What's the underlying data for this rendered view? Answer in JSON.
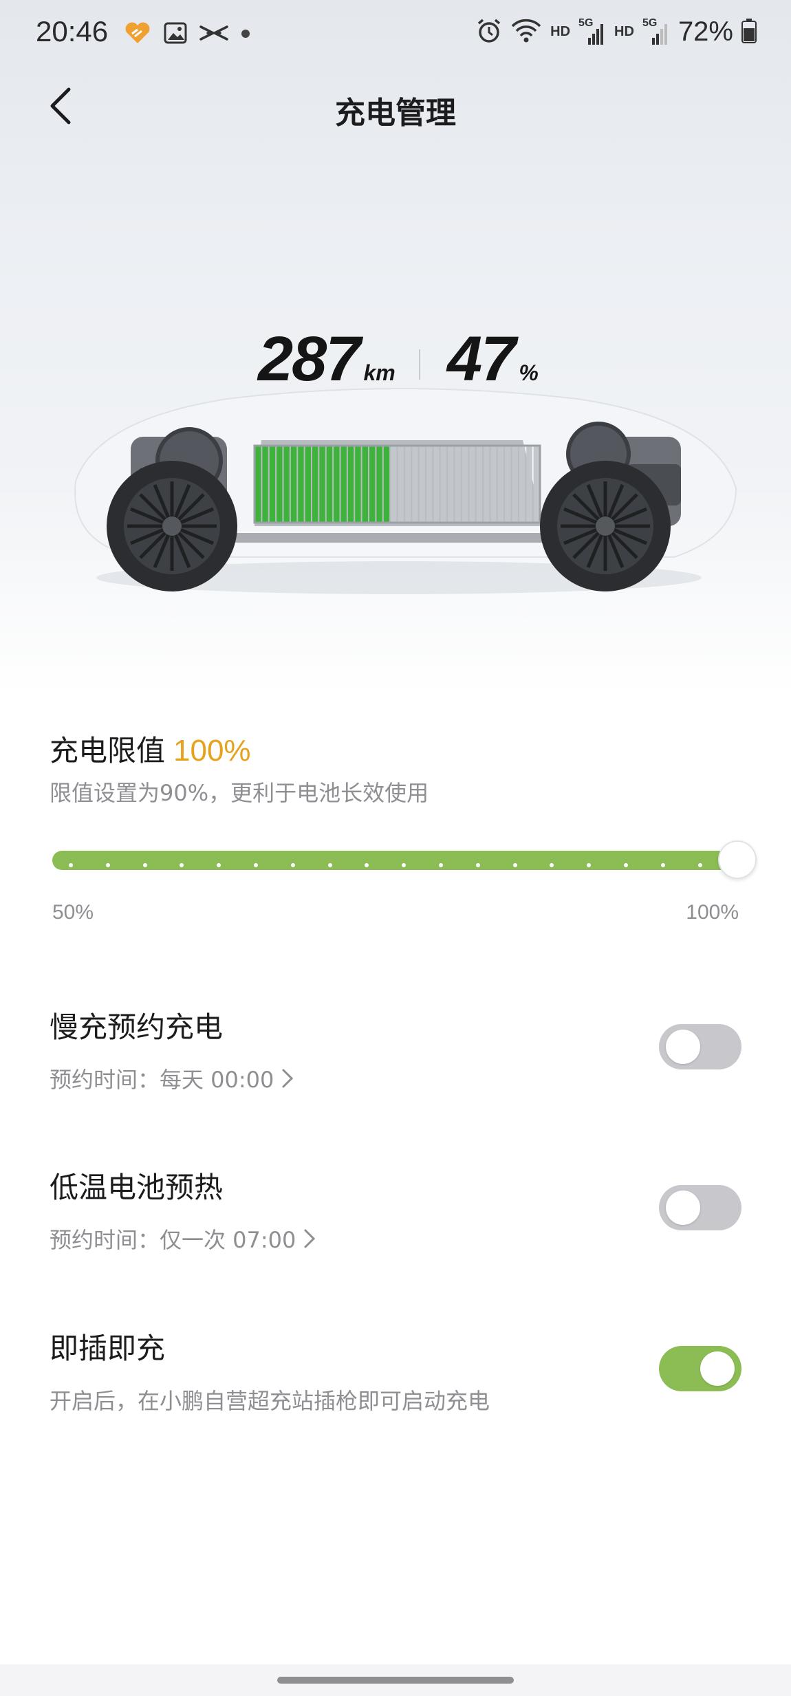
{
  "status_bar": {
    "time": "20:46",
    "left_icons": [
      "heart-app-icon",
      "gallery-icon",
      "xpeng-logo-icon",
      "dot-icon"
    ],
    "right_icons": [
      "alarm-icon",
      "wifi-icon",
      "signal-5g-icon",
      "signal-5g-icon",
      "battery-icon"
    ],
    "hd_1": "HD",
    "hd_2": "HD",
    "net_1": "5G",
    "net_2": "5G",
    "battery_percent": "72%"
  },
  "header": {
    "title": "充电管理",
    "back_icon": "chevron-left-icon"
  },
  "hero": {
    "range_value": "287",
    "range_unit": "km",
    "soc_value": "47",
    "soc_unit": "%",
    "battery_fill_fraction": 0.47,
    "colors": {
      "charged": "#3db33b",
      "uncharged": "#c3c7cb"
    }
  },
  "charge_limit": {
    "title": "充电限值",
    "value": "100%",
    "description": "限值设置为90%，更利于电池长效使用",
    "slider_min_label": "50%",
    "slider_max_label": "100%",
    "slider_min": 50,
    "slider_max": 100,
    "slider_value": 100,
    "accent_color": "#e7a11b",
    "track_color": "#8cbd55"
  },
  "settings": [
    {
      "title": "慢充预约充电",
      "subtitle": "预约时间：每天 00:00",
      "has_chevron": true,
      "enabled": false
    },
    {
      "title": "低温电池预热",
      "subtitle": "预约时间：仅一次 07:00",
      "has_chevron": true,
      "enabled": false
    },
    {
      "title": "即插即充",
      "subtitle": "开启后，在小鹏自营超充站插枪即可启动充电",
      "has_chevron": false,
      "enabled": true
    }
  ]
}
